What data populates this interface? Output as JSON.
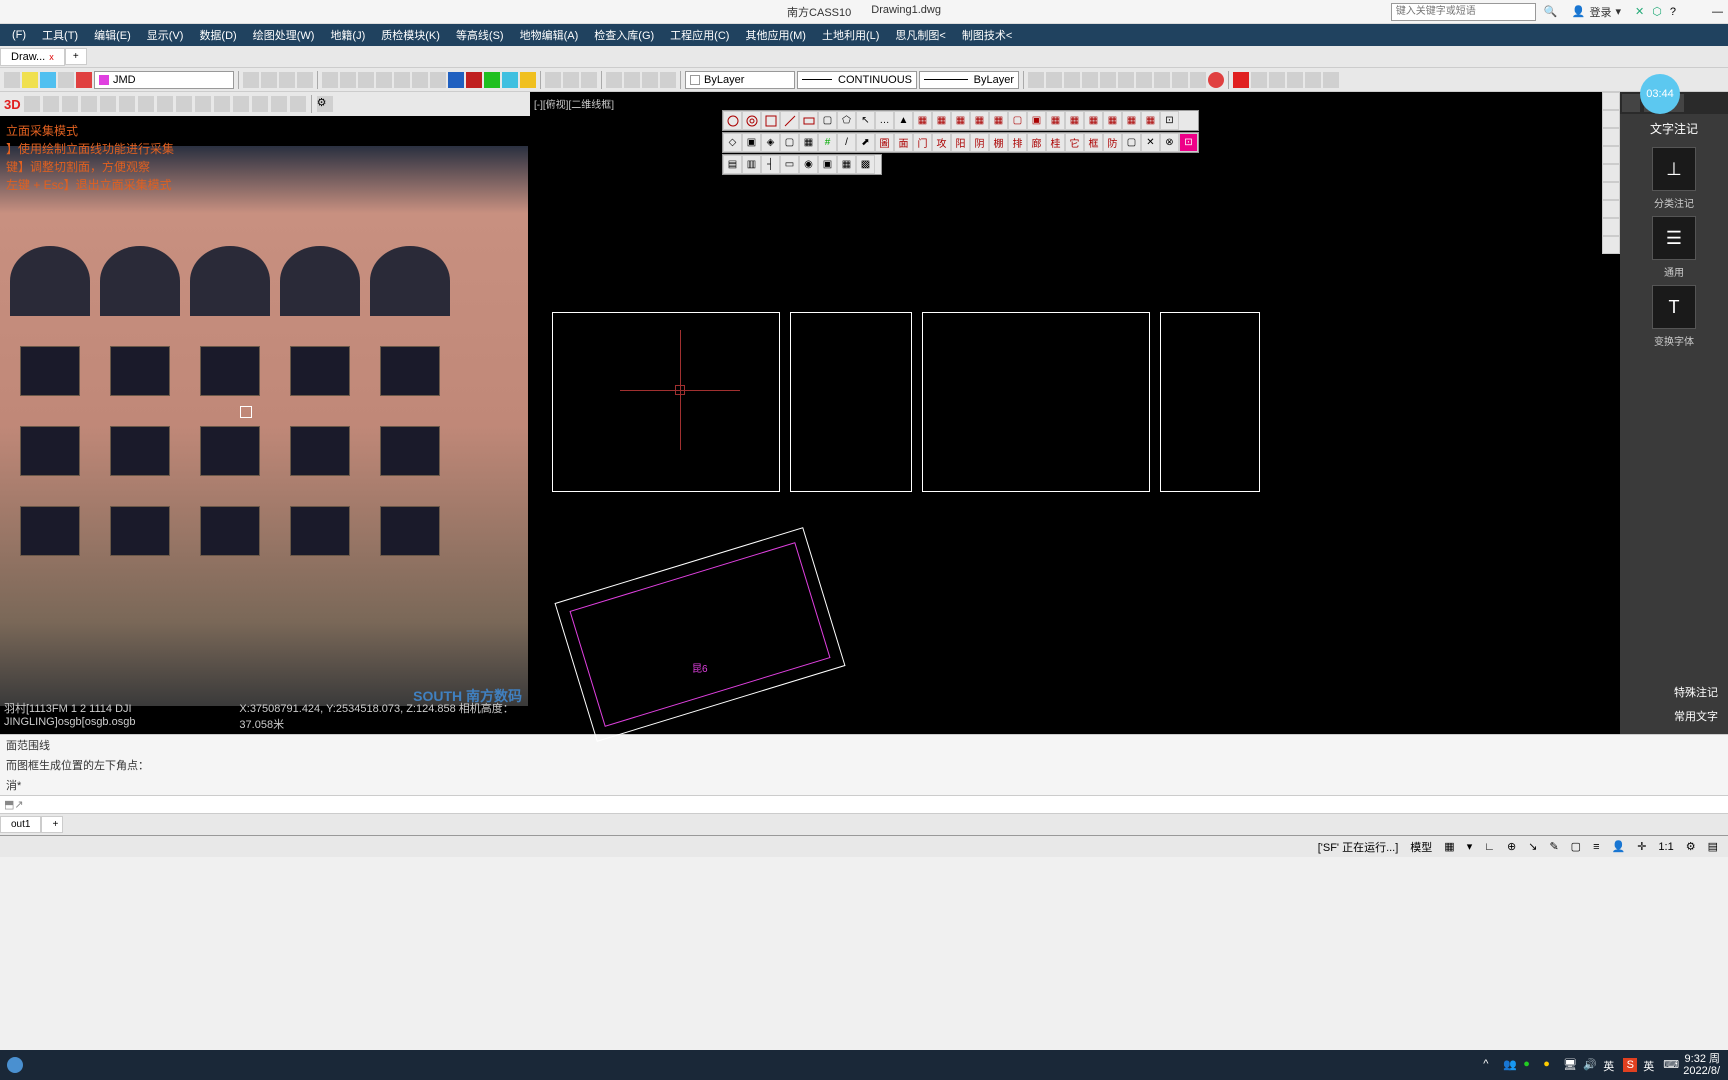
{
  "titlebar": {
    "app": "南方CASS10",
    "file": "Drawing1.dwg",
    "search_placeholder": "键入关键字或短语",
    "login": "登录"
  },
  "menus": [
    "(F)",
    "工具(T)",
    "编辑(E)",
    "显示(V)",
    "数据(D)",
    "绘图处理(W)",
    "地籍(J)",
    "质检模块(K)",
    "等高线(S)",
    "地物编辑(A)",
    "检查入库(G)",
    "工程应用(C)",
    "其他应用(M)",
    "土地利用(L)",
    "思凡制图<",
    "制图技术<"
  ],
  "doctab": {
    "name": "Draw...",
    "close": "x",
    "plus": "+"
  },
  "toolbar1": {
    "layer_label": "JMD",
    "linetype": "CONTINUOUS",
    "lineweight": "ByLayer",
    "color": "ByLayer"
  },
  "left3d": {
    "label": "3D",
    "overlay": [
      "立面采集模式",
      "】使用绘制立面线功能进行采集",
      "键】调整切割面，方便观察",
      "左键 + Esc】退出立面采集模式"
    ],
    "footer_left": "羽村[1113FM 1 2 1114 DJI JINGLING]osgb[osgb.osgb",
    "footer_coords": "X:37508791.424, Y:2534518.073, Z:124.858   相机高度：37.058米",
    "south": "SOUTH 南方数码"
  },
  "rightview": {
    "label": "[-][俯视][二维线框]",
    "shape_label": "昆6"
  },
  "rightpanel": {
    "title": "文字注记",
    "items": [
      {
        "label": "分类注记",
        "glyph": "⊥"
      },
      {
        "label": "通用",
        "glyph": "☰"
      },
      {
        "label": "变换字体",
        "glyph": "T"
      }
    ],
    "bottom": [
      "特殊注记",
      "常用文字"
    ]
  },
  "cmdlines": [
    "面范围线",
    "而图框生成位置的左下角点：",
    "消*"
  ],
  "cmd_prompt": "",
  "layout_tabs": [
    "out1",
    "+"
  ],
  "statusbar": {
    "sf": "['SF' 正在运行...]",
    "model": "模型",
    "ratio": "1:1"
  },
  "timestamp": "03:44",
  "taskbar": {
    "time": "9:32 周",
    "date": "2022/8/",
    "ime": "英"
  }
}
